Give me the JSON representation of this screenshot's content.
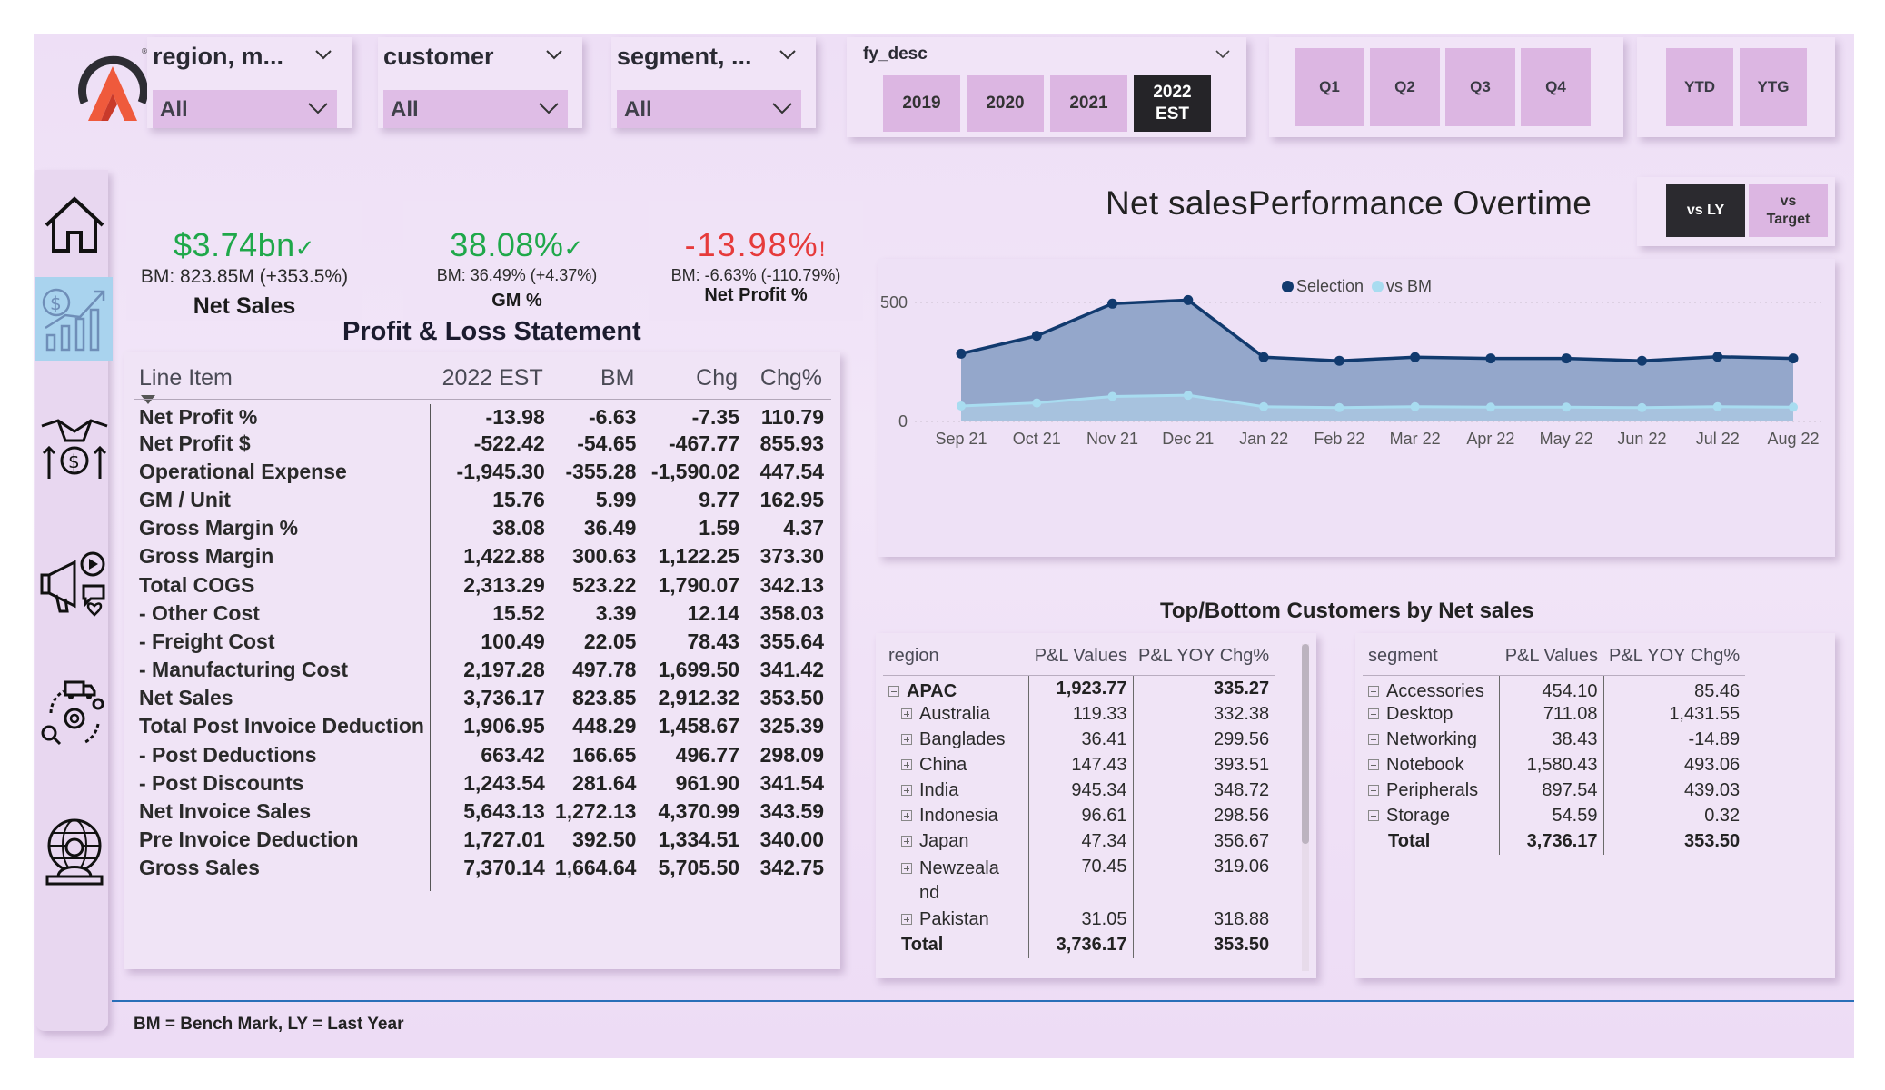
{
  "slicers": [
    {
      "title": "region, m...",
      "value": "All"
    },
    {
      "title": "customer",
      "value": "All"
    },
    {
      "title": "segment, ...",
      "value": "All"
    }
  ],
  "fy": {
    "title": "fy_desc",
    "options": [
      "2019",
      "2020",
      "2021",
      "2022\nEST"
    ],
    "selected": "2022\nEST"
  },
  "quarters": [
    "Q1",
    "Q2",
    "Q3",
    "Q4"
  ],
  "period": [
    "YTD",
    "YTG"
  ],
  "nav": [
    {
      "name": "home",
      "icon": "home-icon"
    },
    {
      "name": "finance",
      "icon": "dollar-growth-chart-icon",
      "active": true
    },
    {
      "name": "deal",
      "icon": "handshake-money-icon"
    },
    {
      "name": "marketing",
      "icon": "megaphone-social-icon"
    },
    {
      "name": "supply-chain",
      "icon": "delivery-truck-gear-icon"
    },
    {
      "name": "executive",
      "icon": "global-person-icon"
    }
  ],
  "kpis": [
    {
      "value": "$3.74bn",
      "mark": "✓",
      "bm": "BM: 823.85M (+353.5%)",
      "name": "Net Sales",
      "status_color": "#1fa84a"
    },
    {
      "value": "38.08%",
      "mark": "✓",
      "bm": "BM: 36.49% (+4.37%)",
      "name": "GM %",
      "status_color": "#1fa84a"
    },
    {
      "value": "-13.98%",
      "mark": "!",
      "bm": "BM: -6.63% (-110.79%)",
      "name": "Net Profit %",
      "status_color": "#e63b3b"
    }
  ],
  "pl": {
    "title": "Profit & Loss Statement",
    "headers": [
      "Line Item",
      "2022 EST",
      "BM",
      "Chg",
      "Chg%"
    ],
    "rows": [
      [
        "Net Profit %",
        "-13.98",
        "-6.63",
        "-7.35",
        "110.79"
      ],
      [
        "Net Profit $",
        "-522.42",
        "-54.65",
        "-467.77",
        "855.93"
      ],
      [
        "Operational Expense",
        "-1,945.30",
        "-355.28",
        "-1,590.02",
        "447.54"
      ],
      [
        "GM / Unit",
        "15.76",
        "5.99",
        "9.77",
        "162.95"
      ],
      [
        "Gross Margin %",
        "38.08",
        "36.49",
        "1.59",
        "4.37"
      ],
      [
        "Gross Margin",
        "1,422.88",
        "300.63",
        "1,122.25",
        "373.30"
      ],
      [
        "Total COGS",
        "2,313.29",
        "523.22",
        "1,790.07",
        "342.13"
      ],
      [
        "- Other Cost",
        "15.52",
        "3.39",
        "12.14",
        "358.03"
      ],
      [
        "- Freight Cost",
        "100.49",
        "22.05",
        "78.43",
        "355.64"
      ],
      [
        "- Manufacturing Cost",
        "2,197.28",
        "497.78",
        "1,699.50",
        "341.42"
      ],
      [
        "Net Sales",
        "3,736.17",
        "823.85",
        "2,912.32",
        "353.50"
      ],
      [
        "Total Post Invoice Deduction",
        "1,906.95",
        "448.29",
        "1,458.67",
        "325.39"
      ],
      [
        "- Post Deductions",
        "663.42",
        "166.65",
        "496.77",
        "298.09"
      ],
      [
        "- Post Discounts",
        "1,243.54",
        "281.64",
        "961.90",
        "341.54"
      ],
      [
        "Net Invoice Sales",
        "5,643.13",
        "1,272.13",
        "4,370.99",
        "343.59"
      ],
      [
        "Pre Invoice Deduction",
        "1,727.01",
        "392.50",
        "1,334.51",
        "340.00"
      ],
      [
        "Gross Sales",
        "7,370.14",
        "1,664.64",
        "5,705.50",
        "342.75"
      ]
    ]
  },
  "chart": {
    "title": "Net salesPerformance Overtime",
    "compare_buttons": [
      {
        "label": "vs LY",
        "active": true
      },
      {
        "label": "vs\nTarget",
        "active": false
      }
    ]
  },
  "chart_data": {
    "type": "area",
    "title": "Net salesPerformance Overtime",
    "categories": [
      "Sep 21",
      "Oct 21",
      "Nov 21",
      "Dec 21",
      "Jan 22",
      "Feb 22",
      "Mar 22",
      "Apr 22",
      "May 22",
      "Jun 22",
      "Jul 22",
      "Aug 22"
    ],
    "series": [
      {
        "name": "Selection",
        "color": "#113a6e",
        "values": [
          285,
          360,
          495,
          510,
          270,
          255,
          270,
          265,
          265,
          255,
          272,
          265
        ]
      },
      {
        "name": "vs BM",
        "color": "#a8dcf0",
        "values": [
          65,
          78,
          105,
          110,
          62,
          58,
          62,
          60,
          60,
          58,
          62,
          60
        ]
      }
    ],
    "yticks": [
      0,
      500
    ],
    "ylim": [
      0,
      600
    ],
    "grid": true,
    "legend": "top-center"
  },
  "customers": {
    "title": "Top/Bottom Customers by Net sales",
    "region_table": {
      "headers": [
        "region",
        "P&L Values",
        "P&L YOY Chg%"
      ],
      "group": {
        "label": "APAC",
        "value": "1,923.77",
        "chg": "335.27"
      },
      "rows": [
        {
          "label": "Australia",
          "value": "119.33",
          "chg": "332.38"
        },
        {
          "label": "Banglades",
          "value": "36.41",
          "chg": "299.56"
        },
        {
          "label": "China",
          "value": "147.43",
          "chg": "393.51"
        },
        {
          "label": "India",
          "value": "945.34",
          "chg": "348.72"
        },
        {
          "label": "Indonesia",
          "value": "96.61",
          "chg": "298.56"
        },
        {
          "label": "Japan",
          "value": "47.34",
          "chg": "356.67"
        },
        {
          "label": "Newzeala",
          "label2": "nd",
          "value": "70.45",
          "chg": "319.06"
        },
        {
          "label": "Pakistan",
          "value": "31.05",
          "chg": "318.88"
        }
      ],
      "total": {
        "label": "Total",
        "value": "3,736.17",
        "chg": "353.50"
      }
    },
    "segment_table": {
      "headers": [
        "segment",
        "P&L Values",
        "P&L YOY Chg%"
      ],
      "rows": [
        {
          "label": "Accessories",
          "value": "454.10",
          "chg": "85.46"
        },
        {
          "label": "Desktop",
          "value": "711.08",
          "chg": "1,431.55"
        },
        {
          "label": "Networking",
          "value": "38.43",
          "chg": "-14.89"
        },
        {
          "label": "Notebook",
          "value": "1,580.43",
          "chg": "493.06"
        },
        {
          "label": "Peripherals",
          "value": "897.54",
          "chg": "439.03"
        },
        {
          "label": "Storage",
          "value": "54.59",
          "chg": "0.32"
        }
      ],
      "total": {
        "label": "Total",
        "value": "3,736.17",
        "chg": "353.50"
      }
    }
  },
  "footer": "BM = Bench Mark, LY = Last Year"
}
